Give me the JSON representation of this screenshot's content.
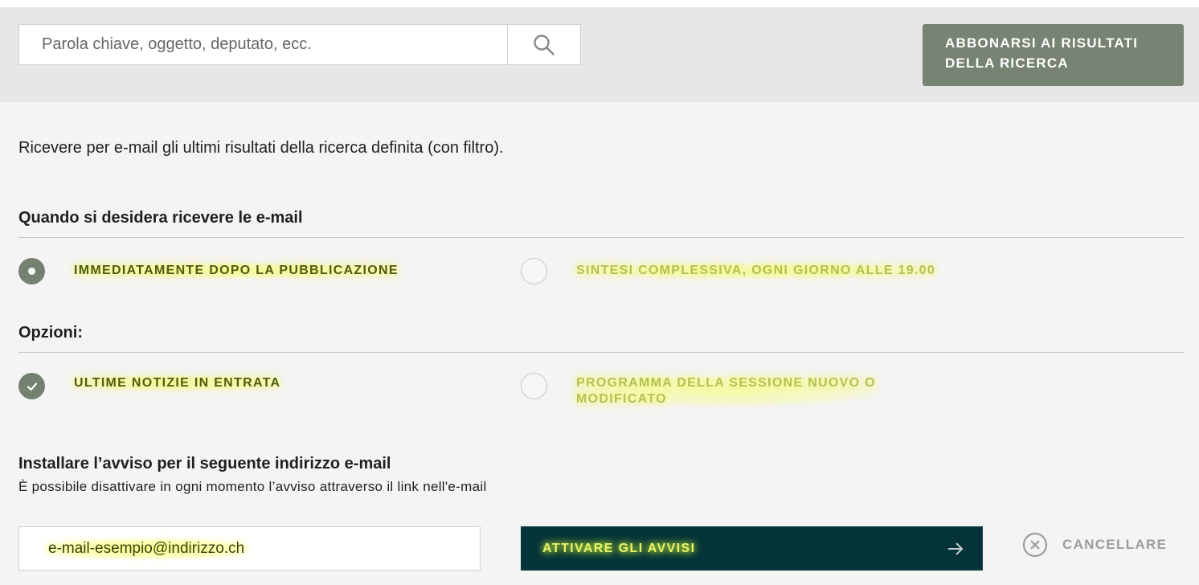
{
  "search": {
    "placeholder": "Parola chiave, oggetto, deputato, ecc.",
    "icon": "search-icon"
  },
  "subscribe_button": {
    "line1": "ABBONARSI AI RISULTATI",
    "line2": "DELLA RICERCA"
  },
  "intro_text": "Ricevere per e-mail gli ultimi risultati della ricerca definita (con filtro).",
  "frequency": {
    "title": "Quando si desidera ricevere le e-mail",
    "options": [
      {
        "label": "IMMEDIATAMENTE DOPO LA PUBBLICAZIONE",
        "selected": true
      },
      {
        "label": "SINTESI COMPLESSIVA, OGNI GIORNO ALLE 19.00",
        "selected": false
      }
    ]
  },
  "options": {
    "title": "Opzioni:",
    "items": [
      {
        "label": "ULTIME NOTIZIE IN ENTRATA",
        "checked": true
      },
      {
        "label_line1": "PROGRAMMA DELLA SESSIONE NUOVO O",
        "label_line2": "MODIFICATO",
        "checked": false
      }
    ]
  },
  "email": {
    "title": "Installare l’avviso per il seguente indirizzo e-mail",
    "hint": "È possibile disattivare in ogni momento l’avviso attraverso il link nell'e-mail",
    "value": "e-mail-esempio@indirizzo.ch"
  },
  "activate_button": {
    "label": "ATTIVARE GLI AVVISI",
    "icon": "arrow-right-icon"
  },
  "cancel_button": {
    "label": "CANCELLARE",
    "icon": "close-circle-icon"
  },
  "colors": {
    "accent_green": "#748070",
    "dark_teal": "#04333a",
    "highlight": "#f6ff6a"
  }
}
